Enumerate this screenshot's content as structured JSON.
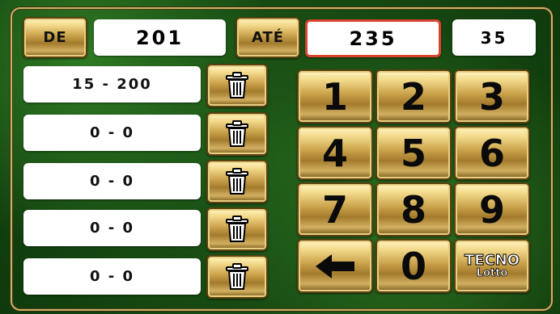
{
  "header": {
    "from_label": "DE",
    "from_value": "201",
    "to_label": "ATÉ",
    "to_value": "235",
    "count_value": "35"
  },
  "ranges": [
    "15 - 200",
    "0 - 0",
    "0 - 0",
    "0 - 0",
    "0 - 0"
  ],
  "keypad": {
    "keys": [
      "1",
      "2",
      "3",
      "4",
      "5",
      "6",
      "7",
      "8",
      "9"
    ],
    "back_label": "←",
    "zero": "0"
  },
  "logo": {
    "top": "TECNO",
    "bottom": "Lotto"
  },
  "colors": {
    "active_border": "#d8452f",
    "background": "#1f5a18",
    "gold": "#caa24b"
  },
  "icons": {
    "delete": "trash-icon",
    "back": "arrow-left-icon"
  }
}
